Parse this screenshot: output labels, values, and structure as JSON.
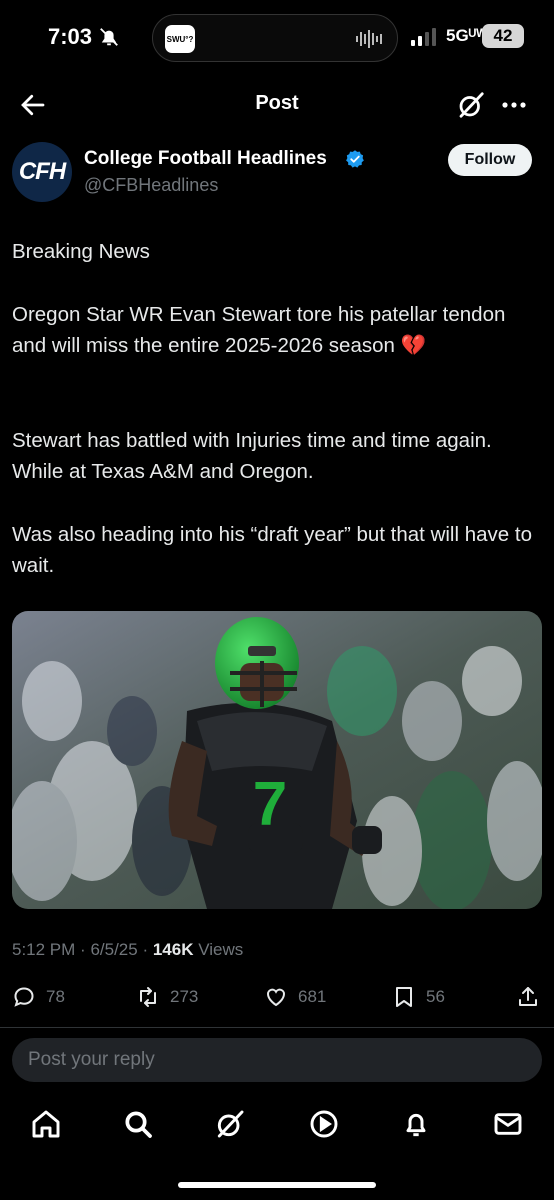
{
  "status_bar": {
    "time": "7:03",
    "island_app": "SWU°?",
    "network": "5Gᵁᵂ",
    "battery": "42"
  },
  "header": {
    "title": "Post"
  },
  "author": {
    "name": "College Football Headlines",
    "handle": "@CFBHeadlines",
    "avatar_text": "CFH",
    "follow_label": "Follow"
  },
  "post": {
    "paragraphs": [
      "Breaking News",
      "Oregon Star WR Evan Stewart tore his patellar tendon and will miss the entire 2025-2026 season 💔",
      "Stewart has battled with Injuries time and time again. While at Texas A&M and Oregon.",
      "Was also heading into his “draft year” but that will have to wait."
    ],
    "jersey_number": "7",
    "time": "5:12 PM",
    "date": "6/5/25",
    "views_count": "146K",
    "views_label": "Views"
  },
  "actions": {
    "replies": "78",
    "reposts": "273",
    "likes": "681",
    "bookmarks": "56"
  },
  "reply": {
    "placeholder": "Post your reply"
  },
  "colors": {
    "background": "#000000",
    "text": "#e7e9ea",
    "muted": "#71767b",
    "verified": "#1d9bf0",
    "oregon_green": "#1fae3a"
  }
}
